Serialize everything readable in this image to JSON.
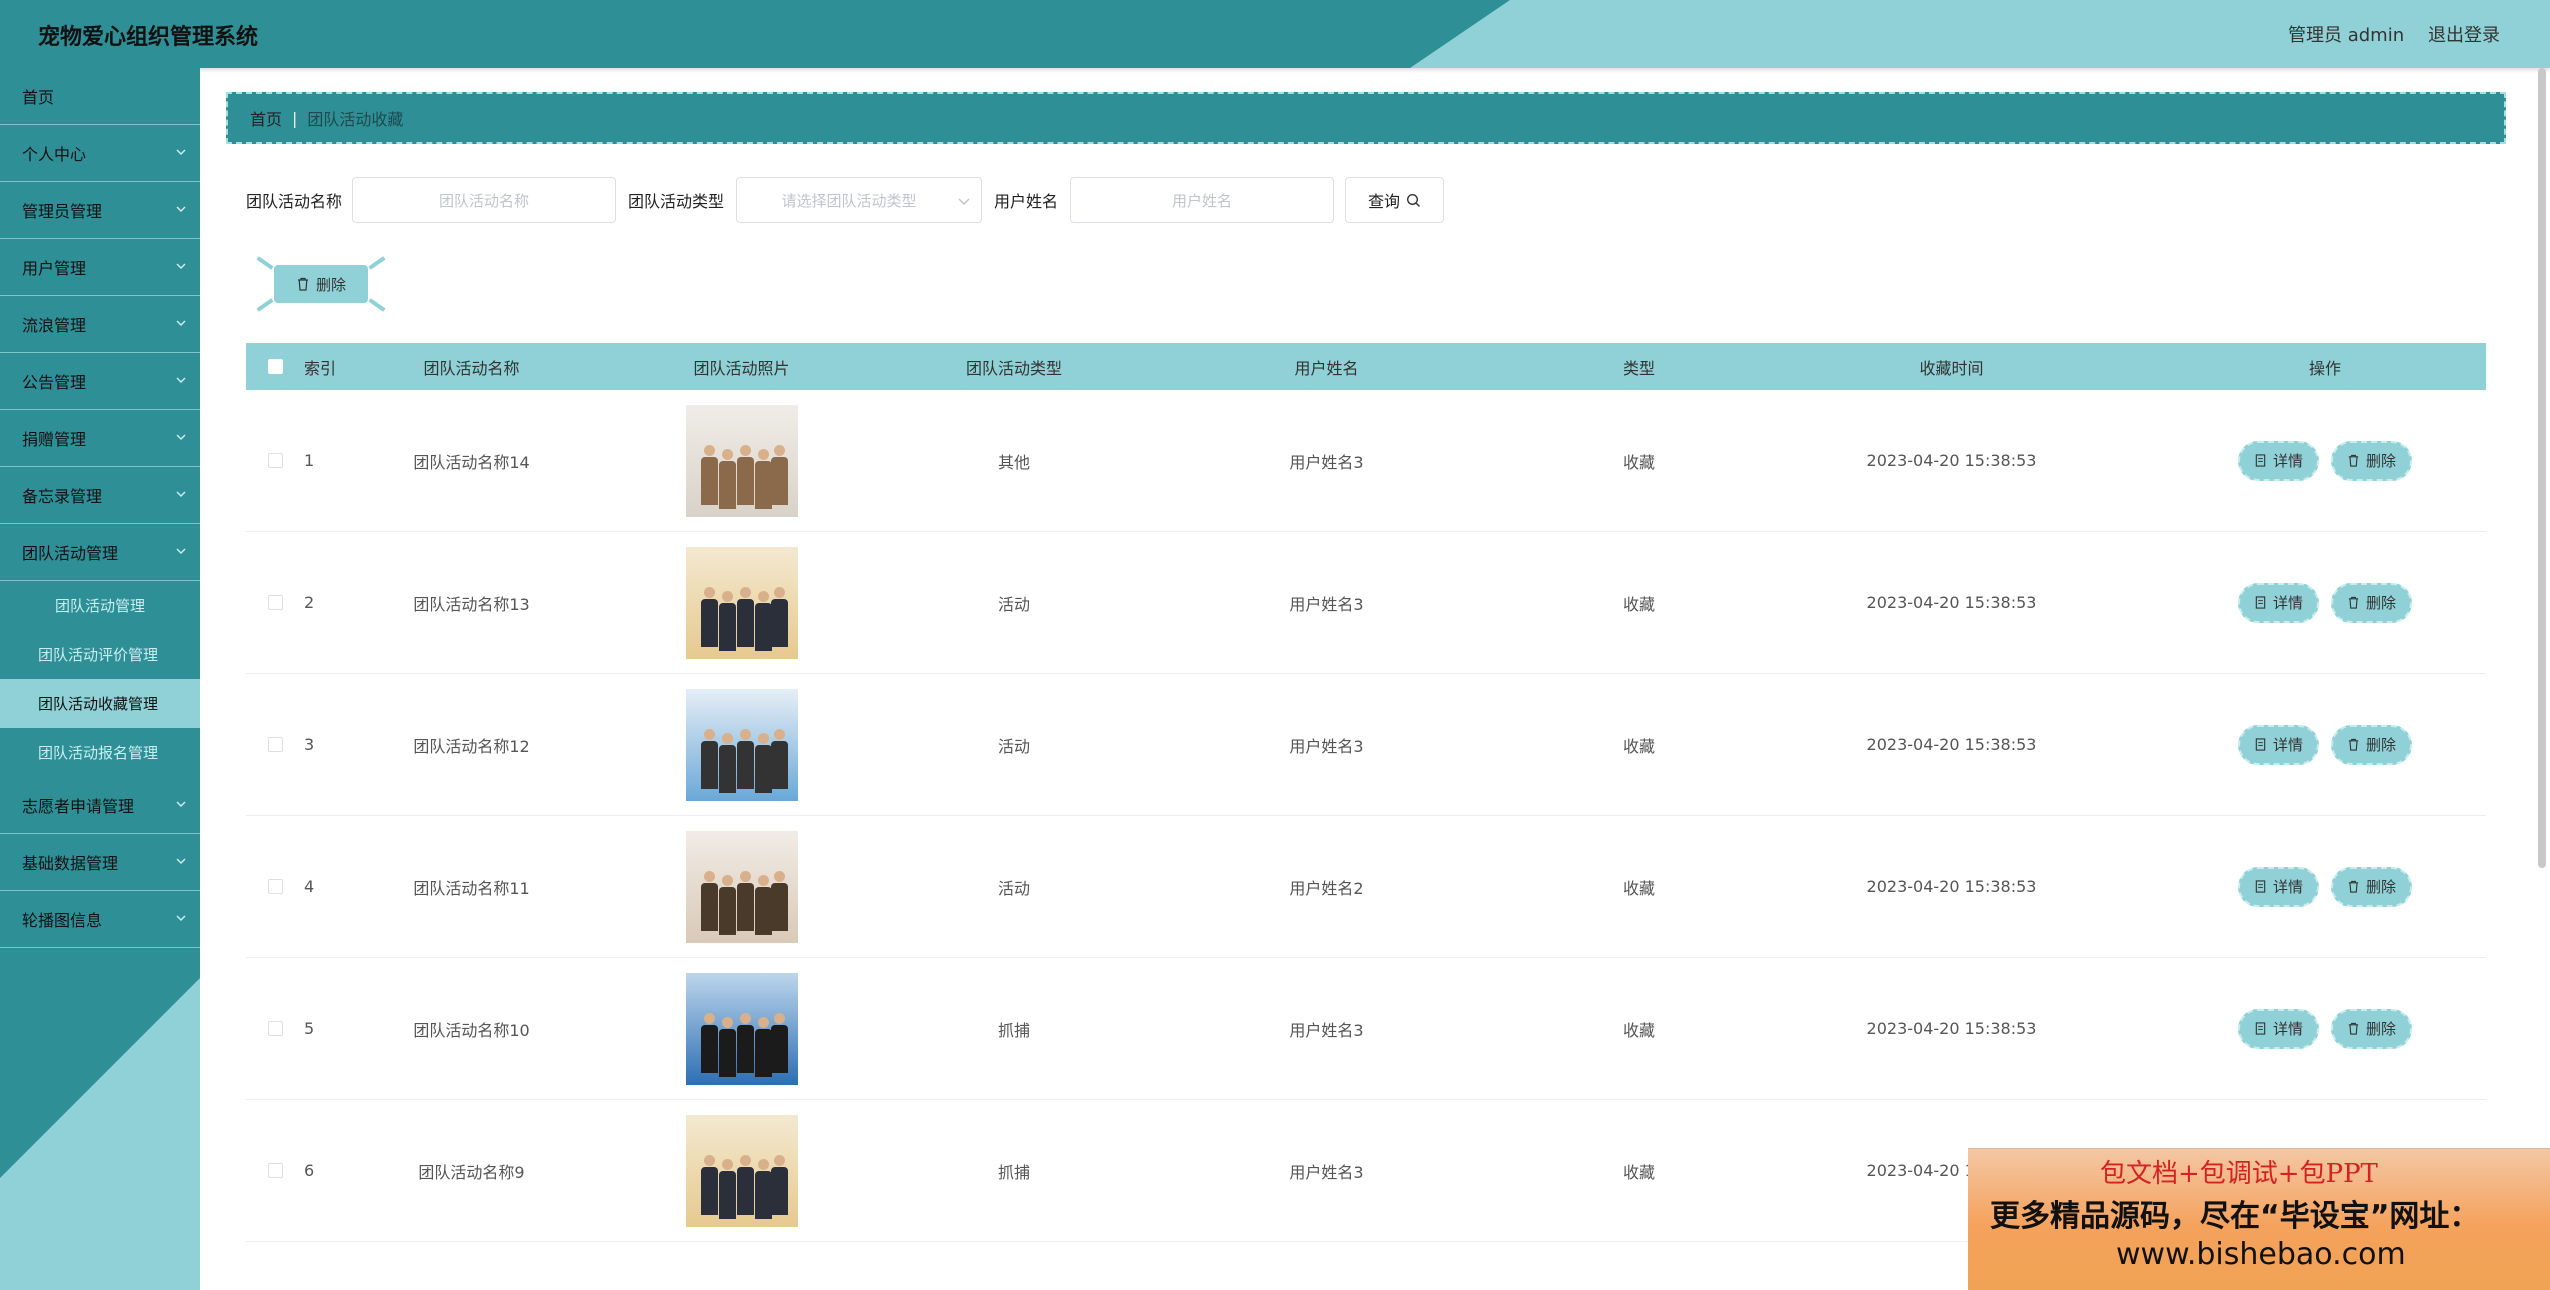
{
  "header": {
    "title": "宠物爱心组织管理系统",
    "admin_label": "管理员 admin",
    "logout_label": "退出登录"
  },
  "sidebar": {
    "items": [
      {
        "label": "首页",
        "has_arrow": false
      },
      {
        "label": "个人中心",
        "has_arrow": true
      },
      {
        "label": "管理员管理",
        "has_arrow": true
      },
      {
        "label": "用户管理",
        "has_arrow": true
      },
      {
        "label": "流浪管理",
        "has_arrow": true
      },
      {
        "label": "公告管理",
        "has_arrow": true
      },
      {
        "label": "捐赠管理",
        "has_arrow": true
      },
      {
        "label": "备忘录管理",
        "has_arrow": true
      },
      {
        "label": "团队活动管理",
        "has_arrow": true,
        "expanded": true
      }
    ],
    "sub_items": [
      {
        "label": "团队活动管理",
        "active": false
      },
      {
        "label": "团队活动评价管理",
        "active": false
      },
      {
        "label": "团队活动收藏管理",
        "active": true
      },
      {
        "label": "团队活动报名管理",
        "active": false
      }
    ],
    "items_after": [
      {
        "label": "志愿者申请管理",
        "has_arrow": true
      },
      {
        "label": "基础数据管理",
        "has_arrow": true
      },
      {
        "label": "轮播图信息",
        "has_arrow": true
      }
    ]
  },
  "breadcrumb": {
    "home": "首页",
    "separator": "|",
    "current": "团队活动收藏"
  },
  "search": {
    "name_label": "团队活动名称",
    "name_placeholder": "团队活动名称",
    "type_label": "团队活动类型",
    "type_placeholder": "请选择团队活动类型",
    "user_label": "用户姓名",
    "user_placeholder": "用户姓名",
    "query_label": "查询"
  },
  "toolbar": {
    "delete_label": "删除"
  },
  "table": {
    "columns": [
      "索引",
      "团队活动名称",
      "团队活动照片",
      "团队活动类型",
      "用户姓名",
      "类型",
      "收藏时间",
      "操作"
    ],
    "detail_label": "详情",
    "delete_label": "删除",
    "rows": [
      {
        "index": "1",
        "name": "团队活动名称14",
        "type": "其他",
        "user": "用户姓名3",
        "kind": "收藏",
        "time": "2023-04-20 15:38:53"
      },
      {
        "index": "2",
        "name": "团队活动名称13",
        "type": "活动",
        "user": "用户姓名3",
        "kind": "收藏",
        "time": "2023-04-20 15:38:53"
      },
      {
        "index": "3",
        "name": "团队活动名称12",
        "type": "活动",
        "user": "用户姓名3",
        "kind": "收藏",
        "time": "2023-04-20 15:38:53"
      },
      {
        "index": "4",
        "name": "团队活动名称11",
        "type": "活动",
        "user": "用户姓名2",
        "kind": "收藏",
        "time": "2023-04-20 15:38:53"
      },
      {
        "index": "5",
        "name": "团队活动名称10",
        "type": "抓捕",
        "user": "用户姓名3",
        "kind": "收藏",
        "time": "2023-04-20 15:38:53"
      },
      {
        "index": "6",
        "name": "团队活动名称9",
        "type": "抓捕",
        "user": "用户姓名3",
        "kind": "收藏",
        "time": "2023-04-20 15:38:53"
      }
    ]
  },
  "ad": {
    "line1": "包文档+包调试+包PPT",
    "line2": "更多精品源码，尽在“毕设宝”网址：",
    "line3": "www.bishebao.com"
  },
  "colors": {
    "primary": "#2f8f97",
    "light": "#8fd1d6"
  }
}
